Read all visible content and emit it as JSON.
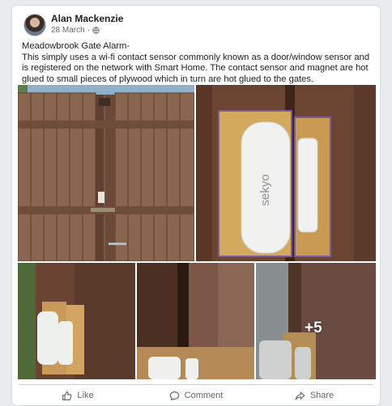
{
  "post": {
    "author": "Alan Mackenzie",
    "date": "28 March",
    "separator": "·",
    "title": "Meadowbrook Gate Alarm-",
    "body": "This simply uses a wi-fi contact sensor commonly known as a door/window sensor and is registered on the network with Smart Home. The contact sensor and magnet are hot glued to small pieces of plywood which in turn are hot glued to the gates.",
    "sensor_brand": "sekyo",
    "more_photos": "+5"
  },
  "actions": {
    "like": "Like",
    "comment": "Comment",
    "share": "Share"
  },
  "icons": {
    "privacy": "globe-icon",
    "like": "thumbs-up-icon",
    "comment": "speech-bubble-icon",
    "share": "share-arrow-icon"
  },
  "colors": {
    "card_bg": "#ffffff",
    "page_bg": "#e9ebee",
    "text": "#1c1e21",
    "secondary_text": "#65676b"
  }
}
